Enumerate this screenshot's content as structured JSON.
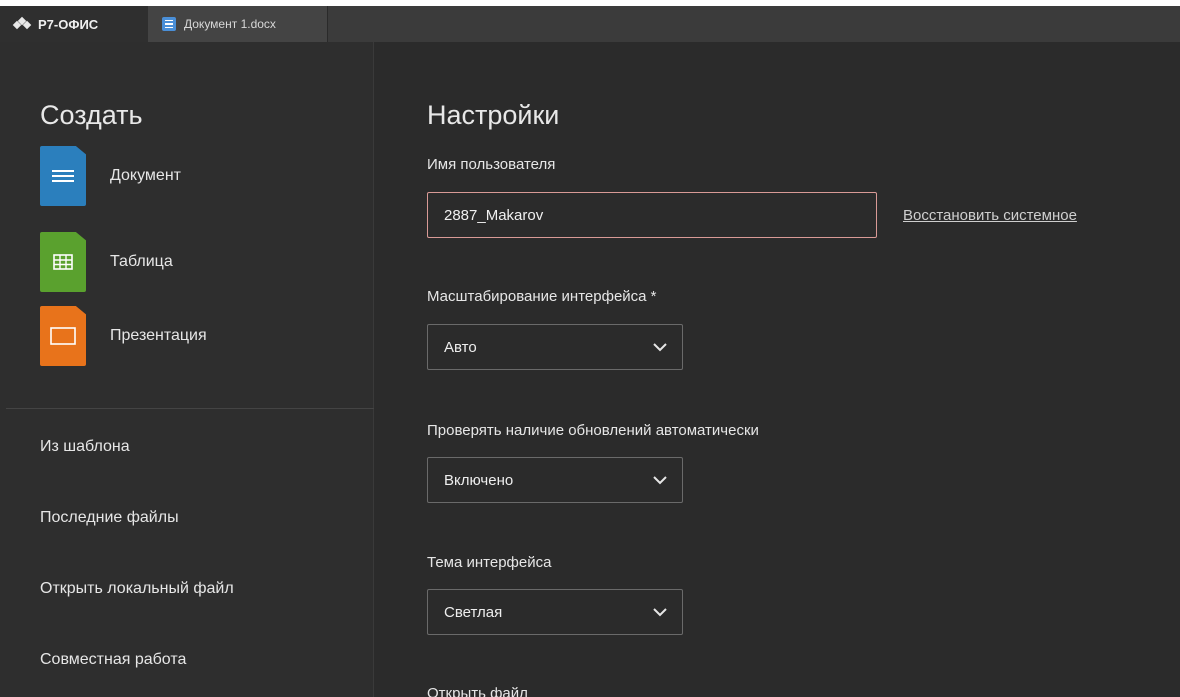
{
  "tabbar": {
    "brand": "Р7-ОФИС",
    "doc_tab": "Документ 1.docx"
  },
  "sidebar": {
    "create_title": "Создать",
    "create_items": [
      {
        "label": "Документ",
        "icon": "document-icon",
        "color": "#2b7fbd"
      },
      {
        "label": "Таблица",
        "icon": "spreadsheet-icon",
        "color": "#5aa12e"
      },
      {
        "label": "Презентация",
        "icon": "presentation-icon",
        "color": "#e8731b"
      }
    ],
    "nav": [
      {
        "label": "Из шаблона"
      },
      {
        "label": "Последние файлы"
      },
      {
        "label": "Открыть локальный файл"
      },
      {
        "label": "Совместная работа"
      }
    ]
  },
  "settings": {
    "title": "Настройки",
    "username": {
      "label": "Имя пользователя",
      "value": "2887_Makarov",
      "restore_link": "Восстановить системное"
    },
    "scale": {
      "label": "Масштабирование интерфейса *",
      "value": "Авто"
    },
    "updates": {
      "label": "Проверять наличие обновлений автоматически",
      "value": "Включено"
    },
    "theme": {
      "label": "Тема интерфейса",
      "value": "Светлая"
    },
    "open_file": {
      "label": "Открыть файл"
    }
  }
}
